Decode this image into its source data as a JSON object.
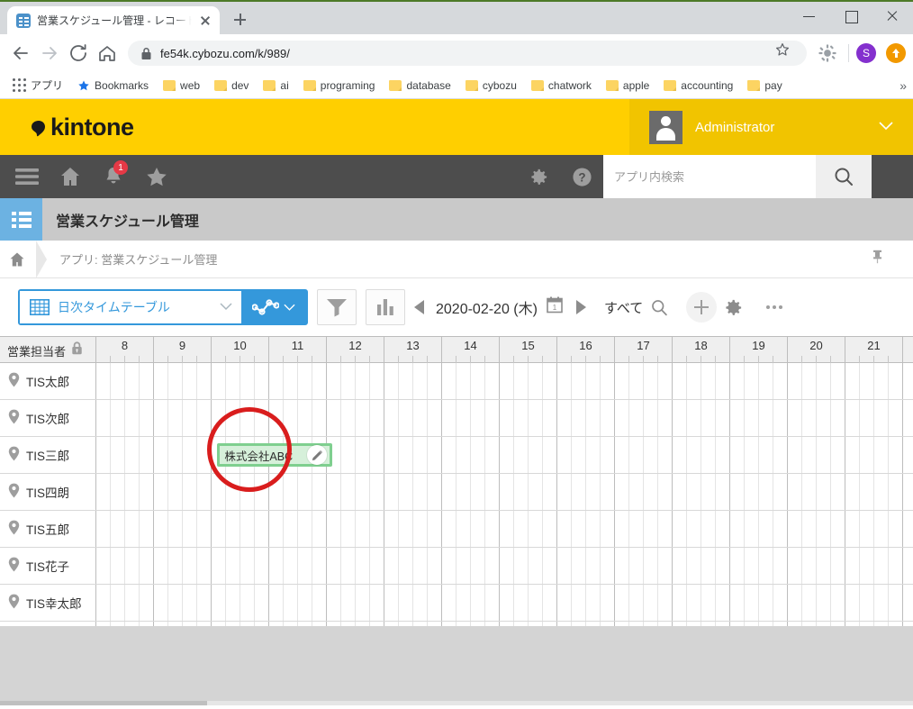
{
  "browser": {
    "tab_title": "営業スケジュール管理 - レコードの一覧",
    "url": "fe54k.cybozu.com/k/989/",
    "new_tab_label": "+",
    "profile_initial": "S",
    "window_controls": {
      "minimize": "–",
      "maximize": "□",
      "close": "✕"
    },
    "bookmarks": [
      {
        "label": "アプリ",
        "icon": "apps-grid-icon"
      },
      {
        "label": "Bookmarks",
        "icon": "star-icon"
      },
      {
        "label": "web",
        "icon": "folder-icon"
      },
      {
        "label": "dev",
        "icon": "folder-icon"
      },
      {
        "label": "ai",
        "icon": "folder-icon"
      },
      {
        "label": "programing",
        "icon": "folder-icon"
      },
      {
        "label": "database",
        "icon": "folder-icon"
      },
      {
        "label": "cybozu",
        "icon": "folder-icon"
      },
      {
        "label": "chatwork",
        "icon": "folder-icon"
      },
      {
        "label": "apple",
        "icon": "folder-icon"
      },
      {
        "label": "accounting",
        "icon": "folder-icon"
      },
      {
        "label": "pay",
        "icon": "folder-icon"
      }
    ],
    "bookmarks_overflow": "»"
  },
  "kintone": {
    "logo_text": "kintone",
    "user_name": "Administrator",
    "notification_count": "1",
    "search_placeholder": "アプリ内検索",
    "app_name": "営業スケジュール管理",
    "breadcrumb": "アプリ: 営業スケジュール管理",
    "colors": {
      "brand_yellow": "#ffcf00",
      "user_yellow": "#f1c400",
      "nav_dark": "#4d4d4d",
      "accent_blue": "#3498db",
      "app_icon_blue": "#6cb2e2",
      "event_green": "#7fcf8f",
      "event_green_light": "#d6f0da",
      "annotation_red": "#d91d1d"
    }
  },
  "toolbar": {
    "view_name": "日次タイムテーブル",
    "date_label": "2020-02-20 (木)",
    "filter_label": "すべて",
    "prev_arrow": "◀",
    "next_arrow": "▶"
  },
  "timetable": {
    "name_column_header": "営業担当者",
    "hours": [
      "8",
      "9",
      "10",
      "11",
      "12",
      "13",
      "14",
      "15",
      "16",
      "17",
      "18",
      "19",
      "20",
      "21"
    ],
    "rows": [
      {
        "name": "TIS太郎",
        "events": []
      },
      {
        "name": "TIS次郎",
        "events": []
      },
      {
        "name": "TIS三郎",
        "events": [
          {
            "title": "株式会社ABC",
            "start_hour": 10.1,
            "end_hour": 12.1
          }
        ]
      },
      {
        "name": "TIS四朗",
        "events": []
      },
      {
        "name": "TIS五郎",
        "events": []
      },
      {
        "name": "TIS花子",
        "events": []
      },
      {
        "name": "TIS幸太郎",
        "events": []
      }
    ]
  }
}
